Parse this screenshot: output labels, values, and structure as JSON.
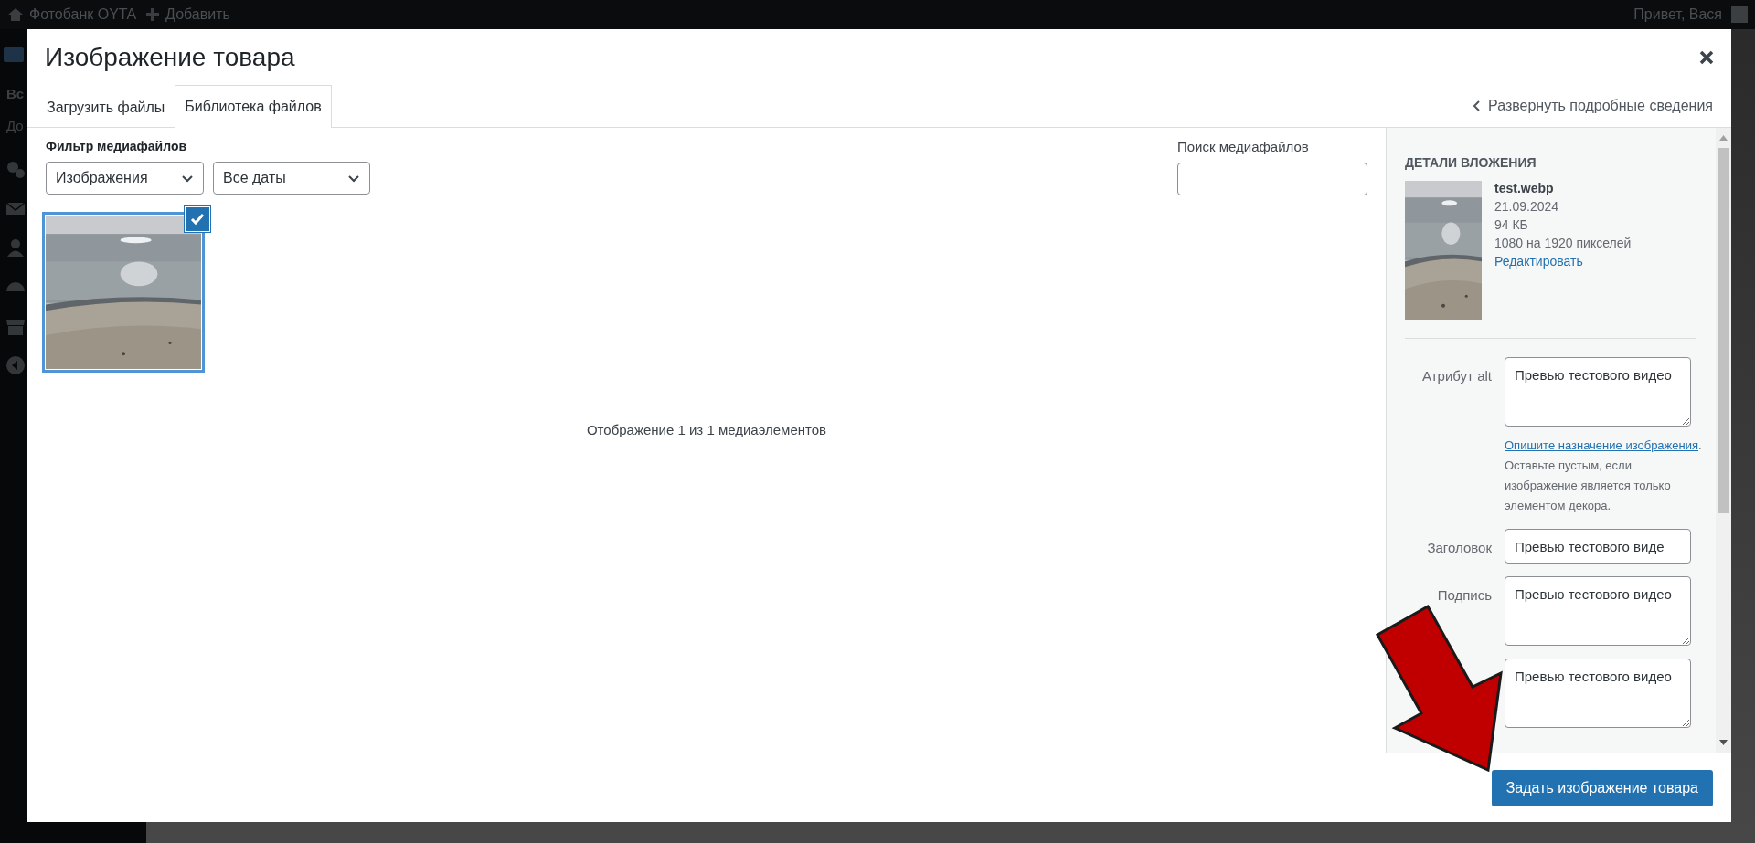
{
  "admin_bar": {
    "site": "Фотобанк OYTA",
    "add": "Добавить",
    "greeting": "Привет, Вася"
  },
  "admin_menu": [
    "Вс",
    "До"
  ],
  "modal": {
    "title": "Изображение товара",
    "tabs": [
      {
        "label": "Загрузить файлы",
        "selected": false
      },
      {
        "label": "Библиотека файлов",
        "selected": true
      }
    ],
    "details_toggle": "Развернуть подробные сведения",
    "filter": {
      "label": "Фильтр медиафайлов",
      "type_select": "Изображения",
      "date_select": "Все даты"
    },
    "search": {
      "label": "Поиск медиафайлов"
    },
    "media": [
      {
        "kind": "picture",
        "selected": true
      }
    ],
    "count_text": "Отображение 1 из 1 медиаэлементов",
    "details": {
      "heading": "ДЕТАЛИ ВЛОЖЕНИЯ",
      "filename": "test.webp",
      "date": "21.09.2024",
      "size": "94 КБ",
      "dimensions": "1080 на 1920 пикселей",
      "edit_link": "Редактировать",
      "fields": [
        {
          "kind": "textarea",
          "label": "Атрибут alt",
          "value": "Превью тестового видео",
          "help_link": "Опишите назначение изображения",
          "help_text": ". Оставьте пустым, если изображение является только элементом декора."
        },
        {
          "kind": "input",
          "label": "Заголовок",
          "value": "Превью тестового виде"
        },
        {
          "kind": "textarea",
          "label": "Подпись",
          "value": "Превью тестового видео"
        },
        {
          "kind": "textarea",
          "value": "Превью тестового видео"
        }
      ]
    },
    "primary_button": "Задать изображение товара"
  }
}
